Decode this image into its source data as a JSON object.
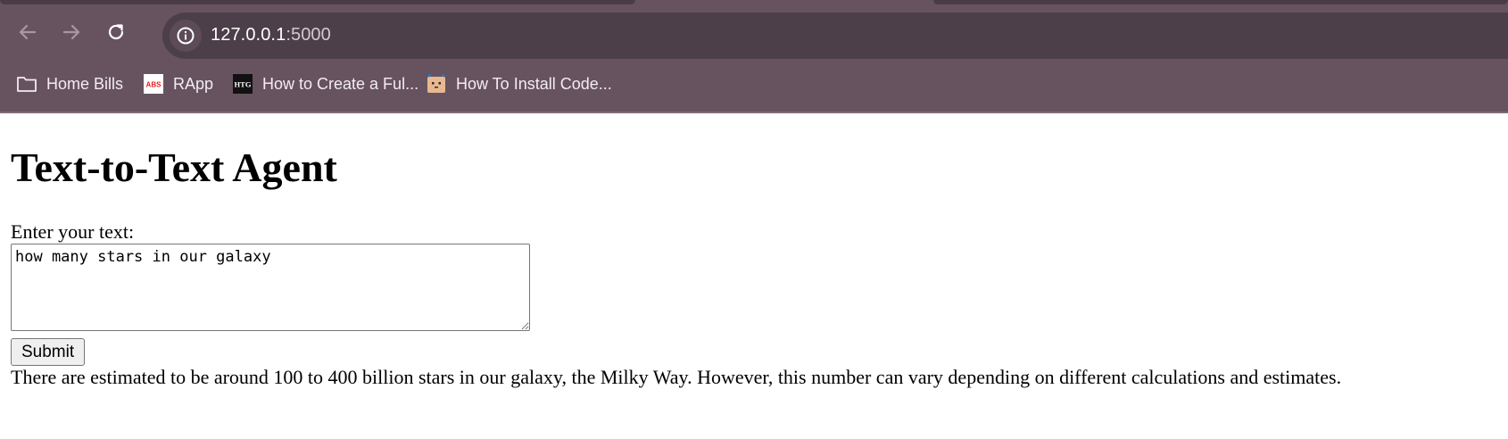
{
  "browser": {
    "url_host": "127.0.0.1",
    "url_port": ":5000",
    "bookmarks": [
      {
        "label": "Home Bills",
        "icon": "folder-icon"
      },
      {
        "label": "RApp",
        "icon": "abs-logo-icon"
      },
      {
        "label": "How to Create a Ful...",
        "icon": "htg-logo-icon"
      },
      {
        "label": "How To Install Code...",
        "icon": "face-favicon-icon"
      }
    ]
  },
  "page": {
    "title": "Text-to-Text Agent",
    "input_label": "Enter your text:",
    "input_value": "how many stars in our galaxy",
    "submit_label": "Submit",
    "response": "There are estimated to be around 100 to 400 billion stars in our galaxy, the Milky Way. However, this number can vary depending on different calculations and estimates."
  },
  "colors": {
    "chrome_bg": "#675360",
    "omnibox_bg": "#4d3f49"
  }
}
